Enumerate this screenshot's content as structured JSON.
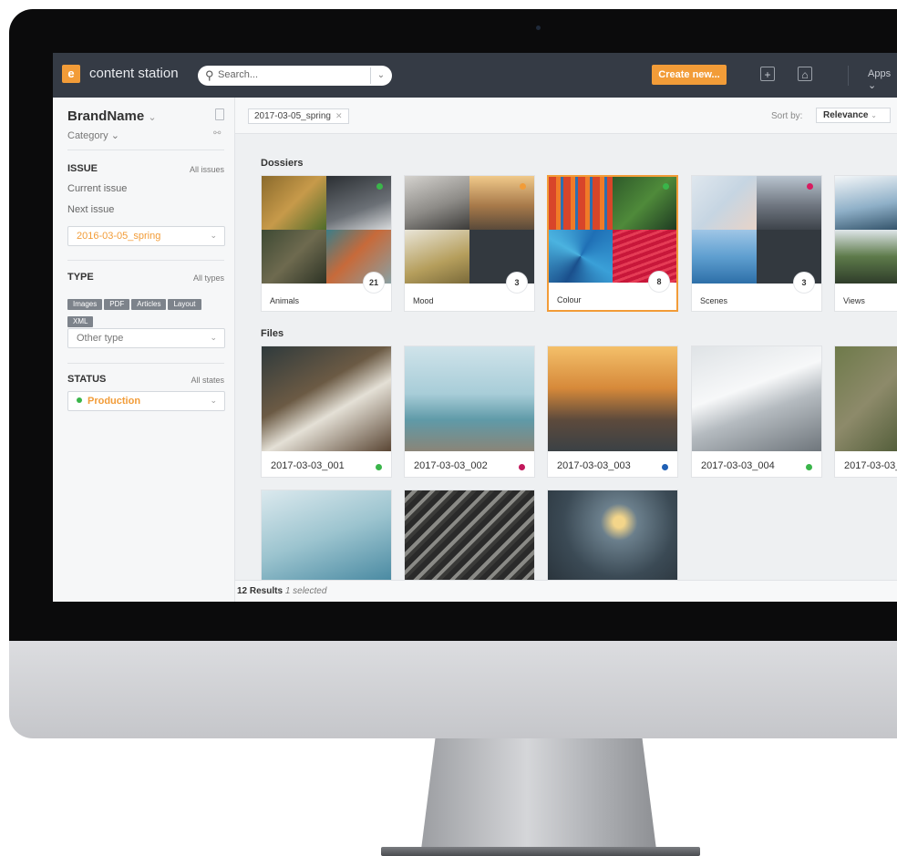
{
  "topbar": {
    "logo_glyph": "e",
    "app_name": "content station",
    "search_placeholder": "Search...",
    "create_label": "Create new...",
    "apps_label": "Apps"
  },
  "sidebar": {
    "brand": "BrandName",
    "category": "Category",
    "issue": {
      "title": "ISSUE",
      "link": "All issues",
      "current": "Current issue",
      "next": "Next issue",
      "selected": "2016-03-05_spring"
    },
    "type": {
      "title": "TYPE",
      "link": "All types",
      "chips": [
        "Images",
        "PDF",
        "Articles",
        "Layout",
        "XML"
      ],
      "other": "Other type"
    },
    "status": {
      "title": "STATUS",
      "link": "All states",
      "selected": "Production"
    }
  },
  "filterbar": {
    "active_filter": "2017-03-05_spring",
    "sort_label": "Sort by:",
    "sort_value": "Relevance"
  },
  "sections": {
    "dossiers": "Dossiers",
    "files": "Files"
  },
  "dossiers": [
    {
      "name": "Animals",
      "count": "21",
      "status_color": "#3ab54a"
    },
    {
      "name": "Mood",
      "count": "3",
      "status_color": "#f29c38"
    },
    {
      "name": "Colour",
      "count": "8",
      "status_color": "#3ab54a"
    },
    {
      "name": "Scenes",
      "count": "3",
      "status_color": "#d81b60"
    },
    {
      "name": "Views",
      "count": "",
      "status_color": ""
    }
  ],
  "files": [
    {
      "name": "2017-03-03_001",
      "status_color": "#3ab54a"
    },
    {
      "name": "2017-03-03_002",
      "status_color": "#c2185b"
    },
    {
      "name": "2017-03-03_003",
      "status_color": "#1e5fb4"
    },
    {
      "name": "2017-03-03_004",
      "status_color": "#3ab54a"
    },
    {
      "name": "2017-03-03_",
      "status_color": ""
    }
  ],
  "footer": {
    "results": "12 Results",
    "selected": "1 selected"
  },
  "colors": {
    "accent": "#f29c38",
    "topbar": "#353b45"
  }
}
